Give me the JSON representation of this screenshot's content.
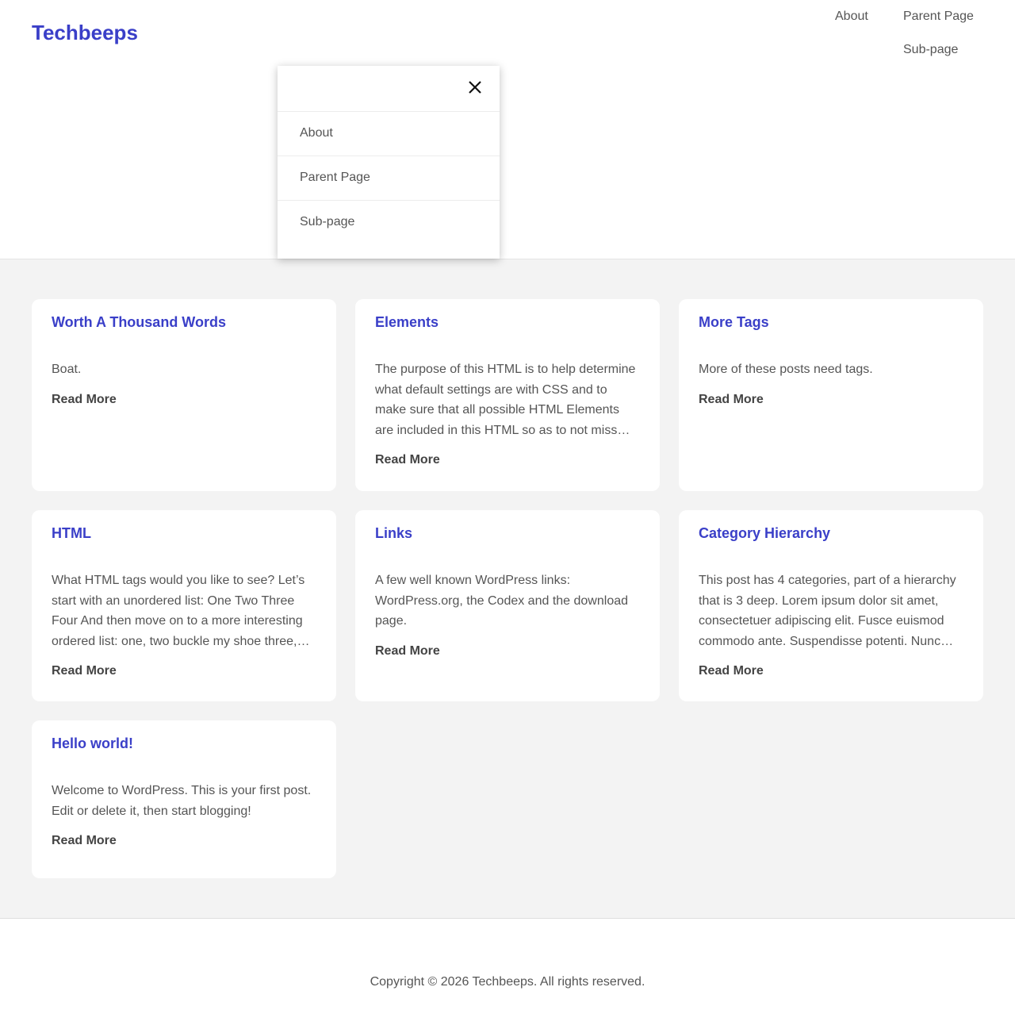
{
  "header": {
    "site_title": "Techbeeps",
    "nav": [
      {
        "label": "About"
      },
      {
        "label": "Parent Page"
      },
      {
        "label": "Sub-page"
      }
    ]
  },
  "menu_panel": {
    "close_icon": "close-icon",
    "items": [
      {
        "label": "About"
      },
      {
        "label": "Parent Page"
      },
      {
        "label": "Sub-page"
      }
    ]
  },
  "posts": [
    {
      "title": "Worth A Thousand Words",
      "excerpt": "Boat.",
      "read_more": "Read More"
    },
    {
      "title": "Elements",
      "excerpt": "The purpose of this HTML is to help determine what default settings are with CSS and to make sure that all possible HTML Elements are included in this HTML so as to not miss…",
      "read_more": "Read More"
    },
    {
      "title": "More Tags",
      "excerpt": "More of these posts need tags.",
      "read_more": "Read More"
    },
    {
      "title": "HTML",
      "excerpt": "What HTML tags would you like to see? Let’s start with an unordered list: One Two Three Four And then move on to a more interesting ordered list: one, two buckle my shoe three,…",
      "read_more": "Read More"
    },
    {
      "title": "Links",
      "excerpt": "A few well known WordPress links: WordPress.org, the Codex and the download page.",
      "read_more": "Read More"
    },
    {
      "title": "Category Hierarchy",
      "excerpt": "This post has 4 categories, part of a hierarchy that is 3 deep. Lorem ipsum dolor sit amet, consectetuer adipiscing elit. Fusce euismod commodo ante. Suspendisse potenti. Nunc…",
      "read_more": "Read More"
    },
    {
      "title": "Hello world!",
      "excerpt": "Welcome to WordPress. This is your first post. Edit or delete it, then start blogging!",
      "read_more": "Read More"
    }
  ],
  "footer": {
    "copyright": "Copyright © 2026 Techbeeps. All rights reserved."
  },
  "colors": {
    "accent": "#3a3fc8",
    "background": "#f3f3f3",
    "text": "#555555"
  }
}
